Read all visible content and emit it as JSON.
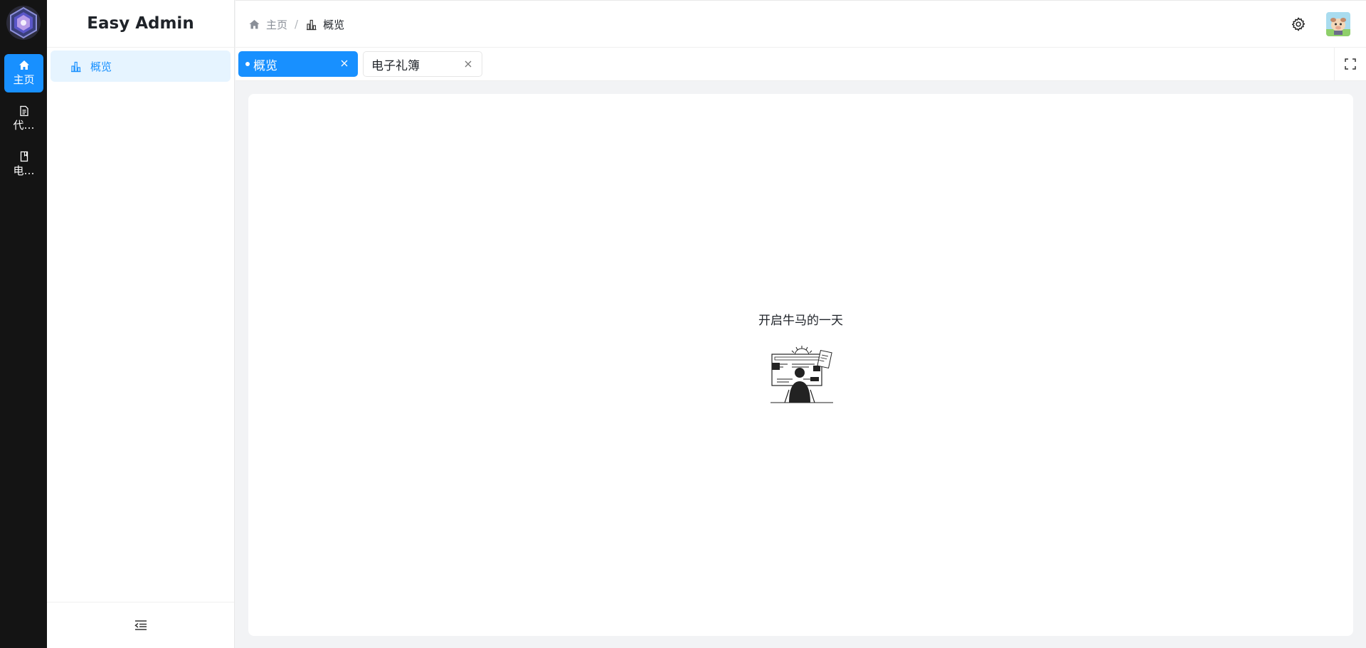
{
  "app": {
    "brand": "Easy Admin"
  },
  "rail": {
    "logo_icon": "hexagon-logo-icon",
    "items": [
      {
        "label": "主页",
        "icon": "home-icon",
        "active": true
      },
      {
        "label": "代…",
        "icon": "document-icon",
        "active": false
      },
      {
        "label": "电…",
        "icon": "book-icon",
        "active": false
      }
    ]
  },
  "sidebar": {
    "items": [
      {
        "label": "概览",
        "icon": "bar-chart-icon",
        "active": true
      }
    ],
    "collapse_icon": "menu-fold-icon"
  },
  "header": {
    "breadcrumb": [
      {
        "label": "主页",
        "icon": "home-icon"
      },
      {
        "label": "概览",
        "icon": "bar-chart-icon"
      }
    ],
    "separator": "/",
    "settings_icon": "gear-icon",
    "avatar_icon": "avatar"
  },
  "tabs": [
    {
      "label": "概览",
      "active": true
    },
    {
      "label": "电子礼簿",
      "active": false
    }
  ],
  "main": {
    "welcome_text": "开启牛马的一天",
    "illustration": "person-at-computer-illustration"
  },
  "colors": {
    "primary": "#1890ff",
    "rail_bg": "#141414",
    "active_menu_bg": "#e6f4ff",
    "page_bg": "#f2f3f5"
  }
}
